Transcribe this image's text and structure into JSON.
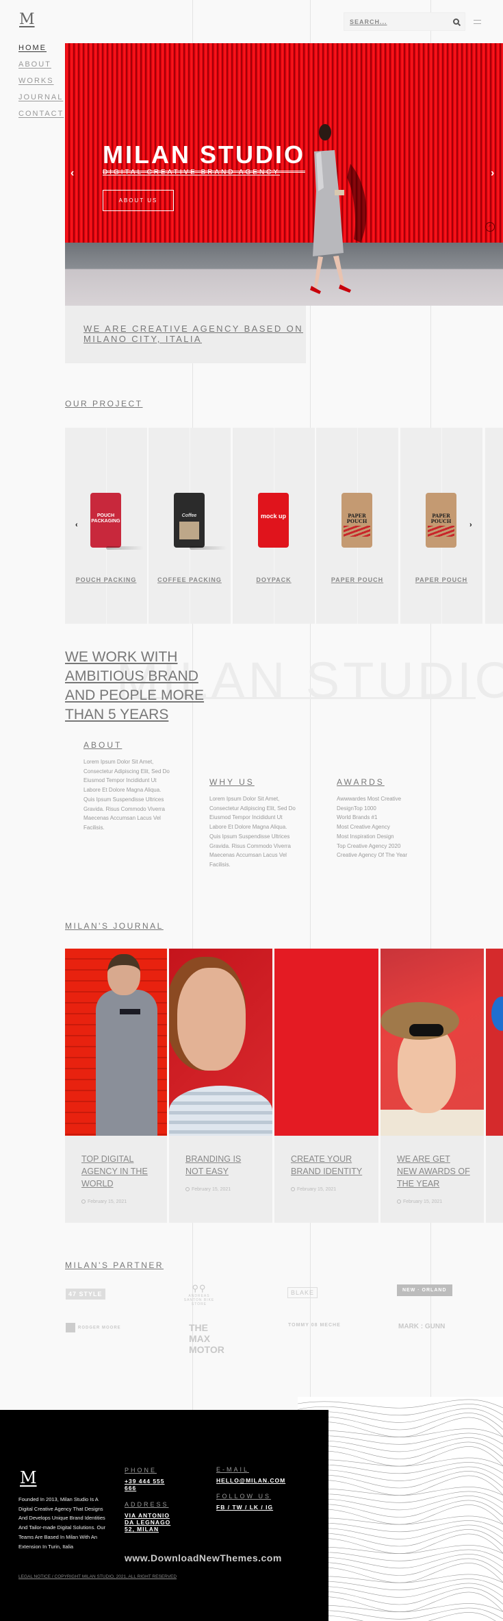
{
  "header": {
    "logo": "M",
    "search_placeholder": "SEARCH...",
    "search_icon": "search-icon",
    "menu_icon": "hamburger-icon"
  },
  "nav": {
    "items": [
      {
        "label": "HOME",
        "active": true
      },
      {
        "label": "ABOUT",
        "active": false
      },
      {
        "label": "WORKS",
        "active": false
      },
      {
        "label": "JOURNAL",
        "active": false
      },
      {
        "label": "CONTACT",
        "active": false
      }
    ]
  },
  "hero": {
    "title": "MILAN STUDIO",
    "subtitle": "DIGITAL CREATIVE BRAND AGENCY",
    "button": "ABOUT US",
    "prev_icon": "‹",
    "next_icon": "›",
    "scroll_up_icon": "^"
  },
  "agency": {
    "text": "WE ARE CREATIVE AGENCY BASED ON MILANO CITY, ITALIA"
  },
  "projects": {
    "title": "OUR PROJECT",
    "prev_icon": "‹",
    "next_icon": "›",
    "items": [
      {
        "label": "POUCH PACKING",
        "pack_text": "POUCH PACKAGING",
        "color": "#c8283c"
      },
      {
        "label": "COFFEE PACKING",
        "pack_text": "Coffee",
        "color": "#2b2b2b"
      },
      {
        "label": "DOYPACK",
        "pack_text": "mock up",
        "color": "#e0141c"
      },
      {
        "label": "PAPER POUCH",
        "pack_text": "PAPER POUCH",
        "color": "#c49a72"
      },
      {
        "label": "PAPER POUCH",
        "pack_text": "PAPER POUCH",
        "color": "#c49a72"
      }
    ]
  },
  "about_section": {
    "watermark": "MILAN STUDIO",
    "headline": "WE WORK WITH AMBITIOUS BRAND AND PEOPLE MORE THAN 5 YEARS",
    "columns": [
      {
        "title": "ABOUT",
        "text": "Lorem Ipsum Dolor Sit Amet, Consectetur Adipiscing Elit, Sed Do Eiusmod Tempor Incididunt Ut Labore Et Dolore Magna Aliqua. Quis Ipsum Suspendisse Ultrices Gravida. Risus Commodo Viverra Maecenas Accumsan Lacus Vel Facilisis."
      },
      {
        "title": "WHY US",
        "text": "Lorem Ipsum Dolor Sit Amet, Consectetur Adipiscing Elit, Sed Do Eiusmod Tempor Incididunt Ut Labore Et Dolore Magna Aliqua. Quis Ipsum Suspendisse Ultrices Gravida. Risus Commodo Viverra Maecenas Accumsan Lacus Vel Facilisis."
      },
      {
        "title": "AWARDS",
        "items": [
          "Awwwardes Most Creative",
          "DesignTop 1000",
          "World Brands #1",
          "Most Creative Agency",
          "Most Inspiration Design",
          "Top Creative Agency 2020",
          "Creative Agency Of The Year"
        ]
      }
    ]
  },
  "journal": {
    "title": "MILAN'S JOURNAL",
    "items": [
      {
        "title": "TOP DIGITAL AGENCY IN THE WORLD",
        "date": "February 15, 2021"
      },
      {
        "title": "BRANDING IS NOT EASY",
        "date": "February 15, 2021"
      },
      {
        "title": "CREATE YOUR BRAND IDENTITY",
        "date": "February 15, 2021"
      },
      {
        "title": "WE ARE GET NEW AWARDS OF THE YEAR",
        "date": "February 15, 2021"
      }
    ]
  },
  "partners": {
    "title": "MILAN'S PARTNER",
    "items": [
      "47 STYLE",
      "ANDREAS SANTON BIKE STORE",
      "BLAKE",
      "NEW · ORLAND",
      "RODGER MOORE",
      "THE MAX MOTOR",
      "TOMMY 08 MECHE",
      "MARK : GUNN"
    ]
  },
  "footer": {
    "logo": "M",
    "description": "Founded In 2013, Milan Studio Is A Digital Creative Agency That Designs And Develops Unique Brand Identities And Tailor-made Digital Solutions. Our Teams Are Based In Milan With An Extension In Turin, Italia",
    "phone_label": "PHONE",
    "phone": "+39 444 555 666",
    "address_label": "ADDRESS",
    "address": "VIA ANTONIO DA LEGNAGO 52, MILAN",
    "email_label": "E-MAIL",
    "email": "HELLO@MILAN.COM",
    "follow_label": "FOLLOW US",
    "social": "FB / TW / LK / IG",
    "watermark": "www.DownloadNewThemes.com",
    "legal": "LEGAL NOTICE / COPYRIGHT MILAN STUDIO, 2021, ALL RIGHT RESERVED"
  }
}
